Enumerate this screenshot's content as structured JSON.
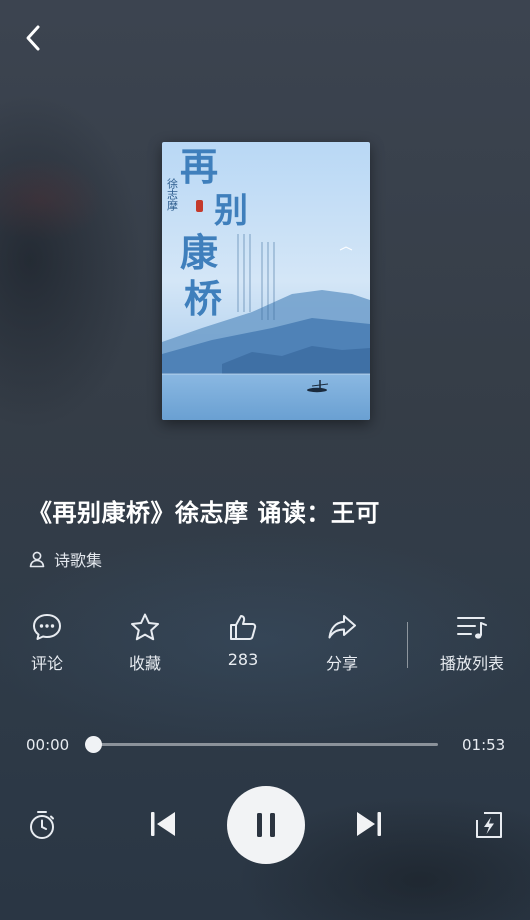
{
  "header": {
    "back_icon": "chevron-left-icon"
  },
  "cover": {
    "title_chars": [
      "再",
      "别",
      "康",
      "桥"
    ],
    "author_vertical": "徐志摩",
    "colors": {
      "sky": "#a9cdef",
      "mountain": "#5f8fc0",
      "water": "#7fb0dc"
    }
  },
  "track": {
    "title": "《再别康桥》徐志摩  诵读：王可",
    "author": "诗歌集",
    "author_icon": "user-icon"
  },
  "actions": [
    {
      "icon": "comment-icon",
      "label": "评论"
    },
    {
      "icon": "star-icon",
      "label": "收藏"
    },
    {
      "icon": "thumbs-up-icon",
      "label": "283"
    },
    {
      "icon": "share-icon",
      "label": "分享"
    },
    {
      "icon": "playlist-icon",
      "label": "播放列表"
    }
  ],
  "progress": {
    "current": "00:00",
    "total": "01:53",
    "fraction": 0.0
  },
  "controls": {
    "timer_icon": "timer-icon",
    "prev_icon": "skip-previous-icon",
    "play_state_icon": "pause-icon",
    "next_icon": "skip-next-icon",
    "speed_icon": "speed-mode-icon"
  },
  "colors": {
    "accent": "#ffffff",
    "play_button_bg": "#f2f3f5"
  }
}
